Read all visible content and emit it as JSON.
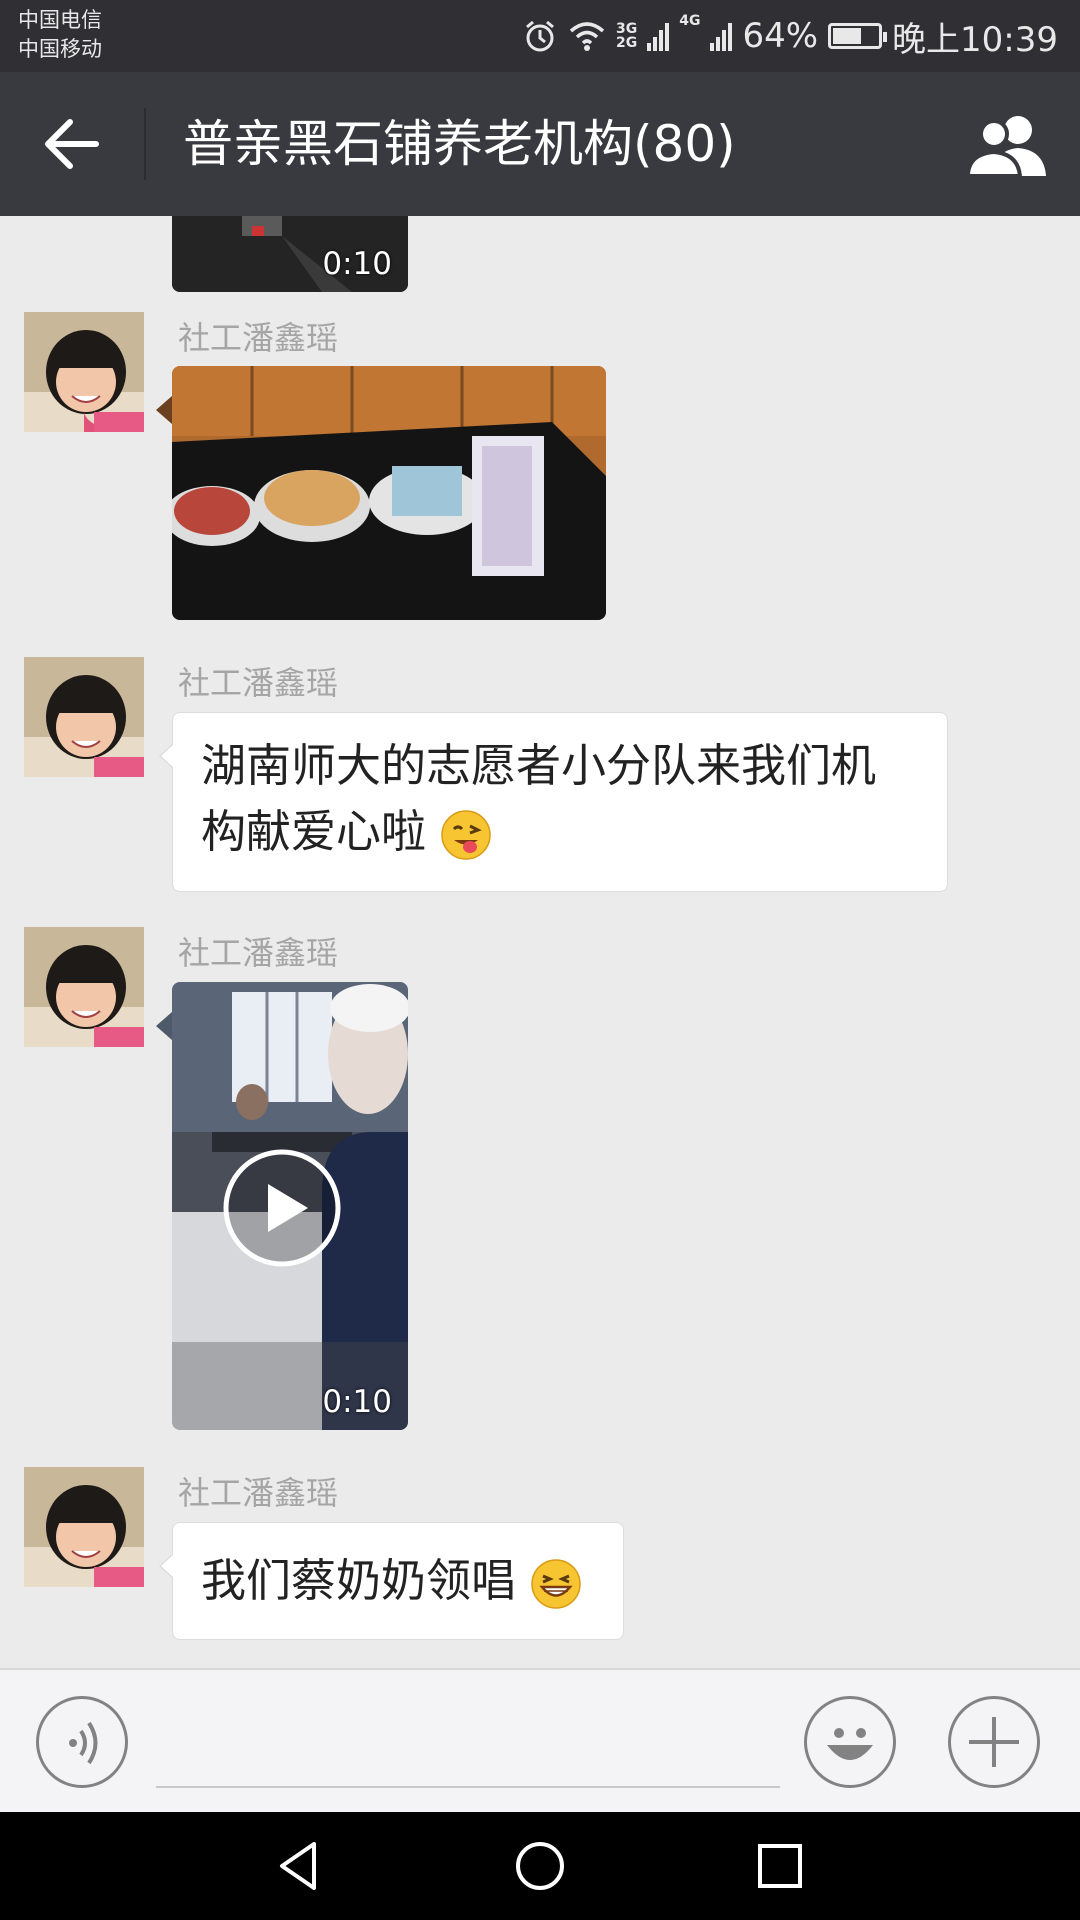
{
  "status_bar": {
    "carrier_1": "中国电信",
    "carrier_2": "中国移动",
    "network_1": "3G",
    "network_2": "2G",
    "network_3": "4G",
    "battery": "64%",
    "battery_level": 0.64,
    "time": "晚上10:39"
  },
  "header": {
    "title": "普亲黑石铺养老机构(80)",
    "back_icon": "arrow-left-icon",
    "members_icon": "group-members-icon"
  },
  "messages": [
    {
      "type": "video",
      "duration": "0:10",
      "partial": true
    },
    {
      "type": "image",
      "sender": "社工潘鑫瑶"
    },
    {
      "type": "text",
      "sender": "社工潘鑫瑶",
      "text": "湖南师大的志愿者小分队来我们机构献爱心啦",
      "emoji": "winking-tongue-face"
    },
    {
      "type": "video",
      "sender": "社工潘鑫瑶",
      "duration": "0:10"
    },
    {
      "type": "text",
      "sender": "社工潘鑫瑶",
      "text": "我们蔡奶奶领唱",
      "emoji": "grinning-face"
    }
  ],
  "input_bar": {
    "voice_icon": "voice-input-icon",
    "emoji_icon": "emoji-icon",
    "plus_icon": "plus-icon",
    "text_value": ""
  },
  "nav_bar": {
    "back": "nav-back-icon",
    "home": "nav-home-icon",
    "recents": "nav-recents-icon"
  }
}
